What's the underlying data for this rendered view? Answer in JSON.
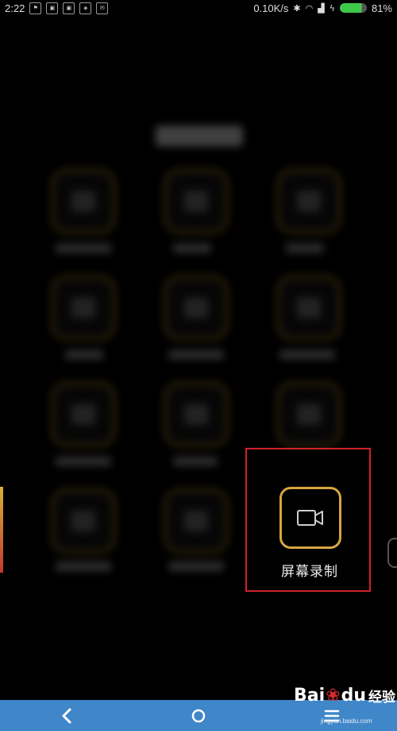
{
  "status_bar": {
    "time": "2:22",
    "speed": "0.10K/s",
    "battery_percent": "81%",
    "battery_level": 0.81,
    "notification_icons": [
      "tag-icon",
      "image-icon",
      "image-icon",
      "shield-icon",
      "message-icon"
    ]
  },
  "highlight": {
    "label": "屏幕录制",
    "icon": "video-camera-icon",
    "frame_color": "#d6a542",
    "box_color": "#d0202a"
  },
  "nav_bar": {
    "back_icon": "chevron-left-icon",
    "home_icon": "circle-home-icon",
    "menu_icon": "menu-icon",
    "color": "#3f87c9"
  },
  "watermark": {
    "brand": "Bai",
    "brand2": "du",
    "suffix": "经验",
    "url": "jingyan.baidu.com"
  }
}
